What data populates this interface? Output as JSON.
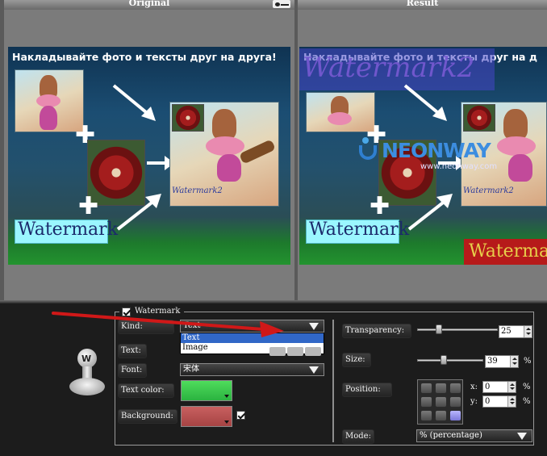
{
  "panes": {
    "original_title": "Original",
    "result_title": "Result"
  },
  "preview": {
    "promo_text": "Накладывайте фото и тексты друг на друга!",
    "promo_text_result": "Накладывайте фото и тексты друг на д",
    "watermark_box_text": "Watermark",
    "small_watermark_text": "Watermark2",
    "result_overlay_text": "Watermark2",
    "result_logo_text": "NEONWAY",
    "result_logo_url": "www.neonway.com",
    "result_bottom_text": "Watermark"
  },
  "watermark_panel": {
    "group_label": "Watermark",
    "group_checked": true,
    "kind_label": "Kind:",
    "kind_value": "Text",
    "kind_options": [
      "Text",
      "Image"
    ],
    "kind_selected_index": 0,
    "text_label": "Text:",
    "font_label": "Font:",
    "font_value": "宋体",
    "text_color_label": "Text color:",
    "text_color": "#4fdc5c",
    "background_label": "Background:",
    "background_color": "#c86060",
    "background_checked": true,
    "transparency_label": "Transparency:",
    "transparency_value": "25",
    "transparency_level": 25,
    "size_label": "Size:",
    "size_value": "39",
    "size_level": 39,
    "size_unit": "%",
    "position_label": "Position:",
    "position_selected_row": 2,
    "position_selected_col": 2,
    "x_label": "x:",
    "x_value": "0",
    "x_unit": "%",
    "y_label": "y:",
    "y_value": "0",
    "y_unit": "%",
    "mode_label": "Mode:",
    "mode_value": "% (percentage)"
  },
  "colors": {
    "selection_blue": "#3167c7",
    "annotation_red": "#d01818"
  },
  "icons": {
    "stamp": "stamp-icon",
    "annotation": "red-arrow-annotation"
  }
}
